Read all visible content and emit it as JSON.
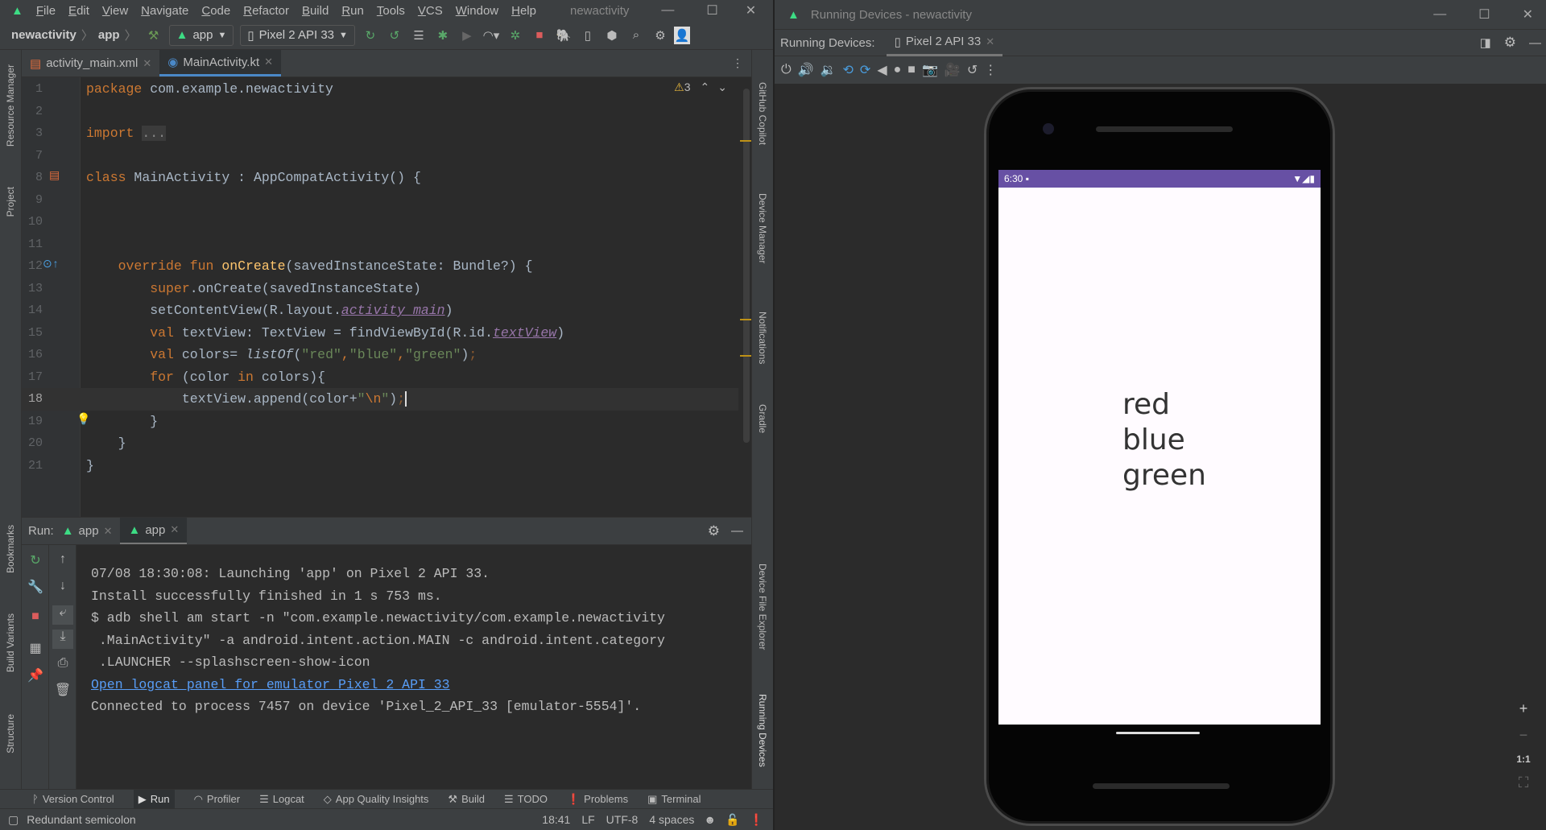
{
  "ide": {
    "menu": [
      "File",
      "Edit",
      "View",
      "Navigate",
      "Code",
      "Refactor",
      "Build",
      "Run",
      "Tools",
      "VCS",
      "Window",
      "Help"
    ],
    "window_title": "newactivity",
    "breadcrumb": [
      "newactivity",
      "app"
    ],
    "run_config": "app",
    "device": "Pixel 2 API 33",
    "tabs": [
      {
        "label": "activity_main.xml"
      },
      {
        "label": "MainActivity.kt"
      }
    ],
    "warnings_count": "3",
    "left_tools": [
      "Resource Manager",
      "Project",
      "Bookmarks",
      "Build Variants",
      "Structure"
    ],
    "right_tools": [
      "GitHub Copilot",
      "Device Manager",
      "Notifications",
      "Gradle",
      "Device File Explorer",
      "Running Devices"
    ],
    "code": [
      {
        "n": "1",
        "t": [
          [
            "package",
            "keyword"
          ],
          [
            " com.example.newactivity",
            ""
          ]
        ]
      },
      {
        "n": "2",
        "t": []
      },
      {
        "n": "3",
        "t": [
          [
            "import",
            "keyword"
          ],
          [
            " ",
            ""
          ],
          [
            "...",
            "fold"
          ]
        ]
      },
      {
        "n": "7",
        "t": []
      },
      {
        "n": "8",
        "t": [
          [
            "class",
            "keyword"
          ],
          [
            " MainActivity : AppCompatActivity() {",
            ""
          ]
        ]
      },
      {
        "n": "9",
        "t": []
      },
      {
        "n": "10",
        "t": []
      },
      {
        "n": "11",
        "t": []
      },
      {
        "n": "12",
        "t": [
          [
            "    override fun ",
            "keyword"
          ],
          [
            "onCreate",
            "fn"
          ],
          [
            "(savedInstanceState: Bundle?) {",
            ""
          ]
        ]
      },
      {
        "n": "13",
        "t": [
          [
            "        super",
            "keyword"
          ],
          [
            ".onCreate(savedInstanceState)",
            ""
          ]
        ]
      },
      {
        "n": "14",
        "t": [
          [
            "        setContentView(R.layout.",
            ""
          ],
          [
            "activity_main",
            "ref"
          ],
          [
            ")",
            ""
          ]
        ]
      },
      {
        "n": "15",
        "t": [
          [
            "        val",
            "keyword"
          ],
          [
            " textView: TextView = findViewById(R.id.",
            ""
          ],
          [
            "textView",
            "ref"
          ],
          [
            ")",
            ""
          ]
        ]
      },
      {
        "n": "16",
        "t": [
          [
            "        val",
            "keyword"
          ],
          [
            " colors= ",
            ""
          ],
          [
            "listOf",
            "italic"
          ],
          [
            "(",
            ""
          ],
          [
            "\"red\"",
            "str"
          ],
          [
            ",",
            "keyword"
          ],
          [
            "\"blue\"",
            "str"
          ],
          [
            ",",
            "keyword"
          ],
          [
            "\"green\"",
            "str"
          ],
          [
            ")",
            ""
          ],
          [
            ";",
            "semi"
          ]
        ]
      },
      {
        "n": "17",
        "t": [
          [
            "        for",
            "keyword"
          ],
          [
            " (color ",
            ""
          ],
          [
            "in",
            "keyword"
          ],
          [
            " colors){",
            ""
          ]
        ]
      },
      {
        "n": "18",
        "t": [
          [
            "            textView.append(color+",
            ""
          ],
          [
            "\"",
            "str"
          ],
          [
            "\\n",
            "keyword"
          ],
          [
            "\"",
            "str"
          ],
          [
            ")",
            ""
          ],
          [
            ";",
            "semi"
          ]
        ]
      },
      {
        "n": "19",
        "t": [
          [
            "        }",
            ""
          ]
        ]
      },
      {
        "n": "20",
        "t": [
          [
            "    }",
            ""
          ]
        ]
      },
      {
        "n": "21",
        "t": [
          [
            "}",
            ""
          ]
        ]
      }
    ],
    "run": {
      "label": "Run:",
      "tabs": [
        "app",
        "app"
      ],
      "console": [
        "07/08 18:30:08: Launching 'app' on Pixel 2 API 33.",
        "Install successfully finished in 1 s 753 ms.",
        "$ adb shell am start -n \"com.example.newactivity/com.example.newactivity",
        " .MainActivity\" -a android.intent.action.MAIN -c android.intent.category",
        " .LAUNCHER --splashscreen-show-icon"
      ],
      "link": "Open logcat panel for emulator Pixel 2 API 33",
      "connected": "Connected to process 7457 on device 'Pixel_2_API_33 [emulator-5554]'."
    },
    "bottom_tools": [
      "Version Control",
      "Run",
      "Profiler",
      "Logcat",
      "App Quality Insights",
      "Build",
      "TODO",
      "Problems",
      "Terminal"
    ],
    "status": {
      "message": "Redundant semicolon",
      "position": "18:41",
      "line_sep": "LF",
      "encoding": "UTF-8",
      "indent": "4 spaces"
    }
  },
  "running_devices": {
    "title": "Running Devices - newactivity",
    "label": "Running Devices:",
    "tab": "Pixel 2 API 33",
    "phone": {
      "time": "6:30",
      "lines": [
        "red",
        "blue",
        "green"
      ],
      "status_color": "#6750a4"
    },
    "zoom": {
      "in": "+",
      "out": "−",
      "actual": "1:1"
    }
  }
}
